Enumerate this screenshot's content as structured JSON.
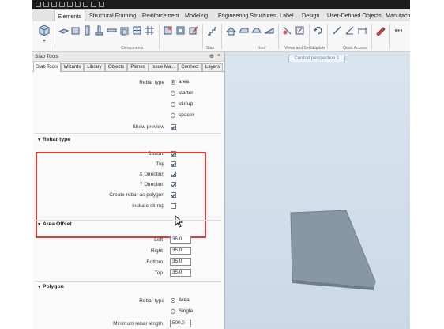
{
  "ribbon": {
    "tabs": [
      "Elements",
      "Structural Framing",
      "Reinforcement",
      "Modeling",
      "Engineering Structures",
      "Label",
      "Design",
      "User-Defined Objects",
      "Manufactu"
    ],
    "active_tab": "Elements",
    "groups": [
      "Components",
      "Stair",
      "Roof",
      "Views and Sectio...",
      "Update",
      "Quick Access"
    ]
  },
  "palette": {
    "title": "Slab Tools",
    "pin": "⊕",
    "close": "×",
    "tabs": [
      "Slab Tools",
      "Wizards",
      "Library",
      "Objects",
      "Planes",
      "Issue Ma...",
      "Connect",
      "Layers"
    ]
  },
  "form": {
    "rebar_type_label": "Rebar type",
    "rebar_options": [
      "area",
      "starter",
      "stirrup",
      "spacer"
    ],
    "selected_rebar": "area",
    "show_preview_label": "Show preview",
    "show_preview": true,
    "rebar_section": {
      "title": "Rebar type",
      "items": [
        {
          "label": "Bottom",
          "checked": true
        },
        {
          "label": "Top",
          "checked": true
        },
        {
          "label": "X Direction",
          "checked": true
        },
        {
          "label": "Y Direction",
          "checked": true
        },
        {
          "label": "Create rebar as polygon",
          "checked": true
        },
        {
          "label": "Include stirrup",
          "checked": false
        }
      ]
    },
    "offset_section": {
      "title": "Area Offset",
      "items": [
        {
          "label": "Left",
          "value": "35.0"
        },
        {
          "label": "Right",
          "value": "35.0"
        },
        {
          "label": "Bottom",
          "value": "35.0"
        },
        {
          "label": "Top",
          "value": "35.0"
        }
      ]
    },
    "polygon_section": {
      "title": "Polygon",
      "rebar_type_label": "Rebar type",
      "options": [
        "Area",
        "Single"
      ],
      "selected": "Area",
      "min_length_label": "Minimum rebar length",
      "min_length_value": "500.0"
    }
  },
  "viewport": {
    "title": "Central perspective 1",
    "slab_color": "#8a9aa8"
  }
}
